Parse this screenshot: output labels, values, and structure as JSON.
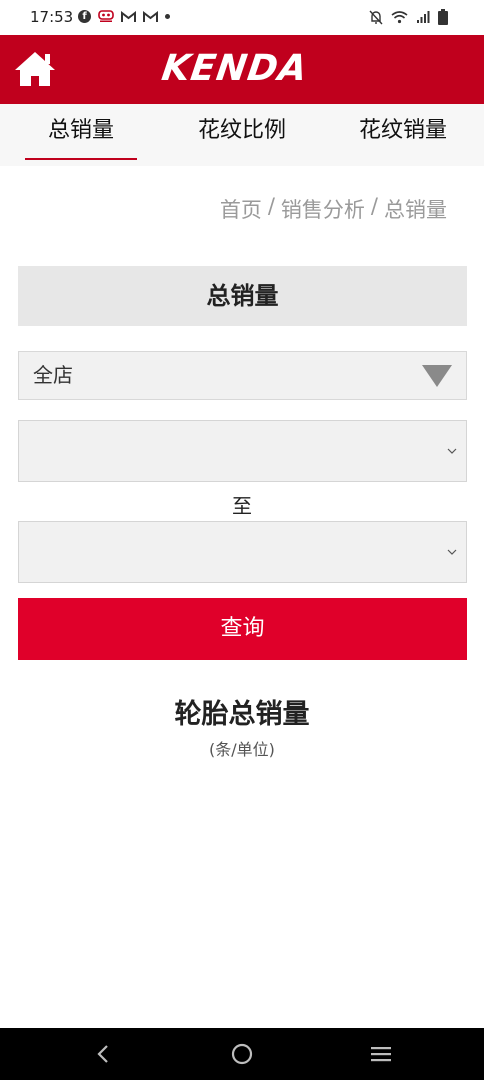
{
  "status_bar": {
    "time": "17:53",
    "icons_left": [
      "facebook-icon",
      "app-notification-icon",
      "gmail-icon",
      "gmail-icon",
      "more-dot-icon"
    ],
    "icons_right": [
      "mute-icon",
      "wifi-icon",
      "signal-icon",
      "battery-icon"
    ]
  },
  "header": {
    "logo_text": "KENDA",
    "home_icon": "home-icon",
    "color": "#c0001d"
  },
  "tabs": [
    {
      "label": "总销量",
      "active": true
    },
    {
      "label": "花纹比例",
      "active": false
    },
    {
      "label": "花纹销量",
      "active": false
    }
  ],
  "breadcrumb": {
    "home": "首页",
    "sep1": "/",
    "section": "销售分析",
    "sep2": "/",
    "current": "总销量"
  },
  "page_title": "总销量",
  "filters": {
    "store_select": "全店",
    "start_date": "",
    "to_label": "至",
    "end_date": ""
  },
  "query_button": "查询",
  "results": {
    "title": "轮胎总销量",
    "unit": "(条/单位)"
  },
  "navbar": {
    "icons": [
      "back-icon",
      "home-circle-icon",
      "recent-apps-icon"
    ]
  },
  "colors": {
    "brand_red": "#c0001d",
    "button_red": "#e0002a"
  }
}
